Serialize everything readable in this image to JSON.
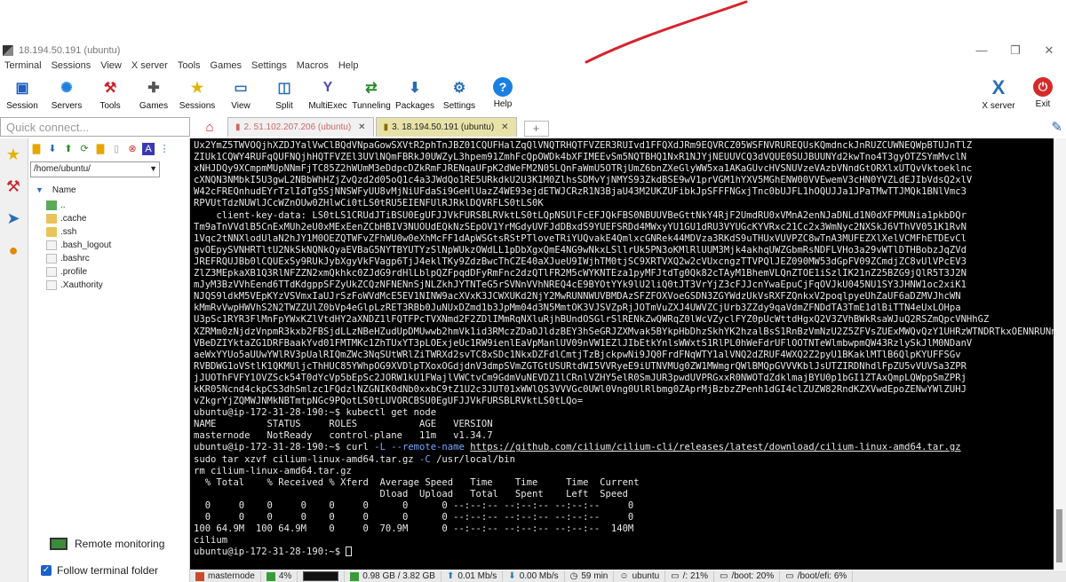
{
  "window": {
    "title": "18.194.50.191 (ubuntu)"
  },
  "menu": [
    "Terminal",
    "Sessions",
    "View",
    "X server",
    "Tools",
    "Games",
    "Settings",
    "Macros",
    "Help"
  ],
  "toolbar": [
    {
      "label": "Session",
      "icon": "session-icon",
      "color": "#1f5fbf"
    },
    {
      "label": "Servers",
      "icon": "servers-icon",
      "color": "#1f7fdf"
    },
    {
      "label": "Tools",
      "icon": "tools-icon",
      "color": "#c8242c"
    },
    {
      "label": "Games",
      "icon": "games-icon",
      "color": "#555555"
    },
    {
      "label": "Sessions",
      "icon": "star-icon",
      "color": "#e3b300"
    },
    {
      "label": "View",
      "icon": "view-icon",
      "color": "#2a6db5"
    },
    {
      "label": "Split",
      "icon": "split-icon",
      "color": "#2a6db5"
    },
    {
      "label": "MultiExec",
      "icon": "multiexec-icon",
      "color": "#4a4ab0"
    },
    {
      "label": "Tunneling",
      "icon": "tunneling-icon",
      "color": "#2a8a2a"
    },
    {
      "label": "Packages",
      "icon": "packages-icon",
      "color": "#2a6db5"
    },
    {
      "label": "Settings",
      "icon": "gear-icon",
      "color": "#2a6db5"
    },
    {
      "label": "Help",
      "icon": "help-icon",
      "color": "#1a7fe0"
    }
  ],
  "toolbar_right": [
    {
      "label": "X server",
      "icon": "xserver-icon",
      "color": "#2a6db5"
    },
    {
      "label": "Exit",
      "icon": "power-icon",
      "color": "#d42a2a"
    }
  ],
  "quick_connect": {
    "placeholder": "Quick connect..."
  },
  "tabs": [
    {
      "label": "2. 51.102.207.206 (ubuntu)",
      "active": false
    },
    {
      "label": "3. 18.194.50.191 (ubuntu)",
      "active": true
    }
  ],
  "sftp": {
    "path": "/home/ubuntu/",
    "column": "Name",
    "files": [
      {
        "name": "..",
        "type": "up"
      },
      {
        "name": ".cache",
        "type": "folder"
      },
      {
        "name": ".ssh",
        "type": "folder"
      },
      {
        "name": ".bash_logout",
        "type": "doc"
      },
      {
        "name": ".bashrc",
        "type": "doc"
      },
      {
        "name": ".profile",
        "type": "doc"
      },
      {
        "name": ".Xauthority",
        "type": "doc"
      }
    ],
    "remote_monitoring": "Remote monitoring",
    "follow_terminal": "Follow terminal folder"
  },
  "terminal": {
    "lines_before": [
      "Ux2YmZ5TWVOQjhXZDJYalVwClBQdVNpaGowSXVtR2phTnJBZ01CQUFHalZqQlVNQTRHQTFVZER3RUIvd1FFQXdJRm9EQVRCZ05WSFNVRUREQUsKQmdnckJnRUZCUWNEQWpBTUJnTlZ",
      "ZIUk1CQWY4RUFqQUFNQjhHQTFVZEl3UVlNQmFBRkJ0UWZyL3hpem91ZmhFcQpOWDk4bXFIMEEvSm5NQTBHQ1NxR1NJYjNEUUVCQ3dVQUE0SUJBUUNYd2kwTno4T3gyOTZSYmMvclN",
      "xNHJDQy9XCmpmMUpNNmFjTC85Z2hWUmM3eDdpcDZkRmFJRENqaUFpK2dWeFM2N05LQnFaWmU5OTRjUmZ6bnZXeGlyWW5xa1AKaGUvcHVSNUVzeVAzbVNndGtORXlxUTQvVktoeklnc",
      "cXNQN3NMbkI5U3gwL2NBbWhHZjZvQzd2d05oQ1c4a3JWdQo1RE5URkdkU2U3K1M0ZlhsSDMvYjNMYS93ZkdBSE9wV1prVGM1hYXV5MGhENW00VVEwemV3cHN0YVZLdEJIbVdsQ2xlV",
      "W42cFREQnhudEYrTzlIdTg5SjNNSWFyUU8vMjNiUFdaSi9GeHlUazZ4WE93ejdETWJCRzR1N3BjaU43M2UKZUFibkJpSFFFNGxjTnc0bUJFL1hOQUJJa1JPaTMwTTJMQk1BNlVmc3",
      "RPVUtTdzNUWlJCcWZnOUw0ZHlwCi0tLS0tRU5EIENFUlRJRklDQVRFLS0tLS0K",
      "    client-key-data: LS0tLS1CRUdJTiBSU0EgUFJJVkFURSBLRVktLS0tLQpNSUlFcEFJQkFBS0NBUUVBeGttNkY4RjF2UmdRU0xVMnA2enNJaDNLd1N0dXFPMUNia1pkbDQr",
      "Tm9aTnVVdlB5CnExMUh2eU0xMExEenZCbHBIV3NUOUdEQkNzSEpOV1YrMGdyUVFJdDBxdS9YUEFSRDd4MWxyYU1GU1dRU3VYUGcKYVRxc21Cc2x3WmNyc2NXSkJ6VThVV051K1RvN",
      "1Vqc2tNNXlodUlaN2hJY1M0OEZQTWFvZFhWU0w0eXhMcFF1dApWSGtsRStPTloveTRiYUQvakE4QmlxcGNRek44MDVza3RKdS9uTHUxVUVPZC8wTnA3MUFEZXlXelVCMFhETDEvCl",
      "gvOEpySVNHRTltU2NkSkNQNkQyaEVBaG5NYTBYUTYzSlNpWUkzOWdLL1pDbXgxQmE4NG9wNkxLSllrUk5PN3oKMlRlUUM3Mjk4akhqUWZGbmRsNDFLVHo3a29vWTlDTHBobzJqZVd",
      "JREFRQUJBb0lCQUExSy9RUkJybXgyVkFVagp6TjJ4eklTKy9ZdzBwcThCZE40aXJueU9IWjhTM0tjSC9XRTVXQ2w2cVUxcngzTTVPQlJEZ090MW53dGpFV09ZCmdjZC8vUlVPcEV3",
      "ZlZ3MEpkaXB1Q3RlNFZZN2xmQkhkc0ZJdG9rdHlLblpQZFpqdDFyRmFnc2dzQTlFR2M5cWYKNTEza1pyMFJtdTg0Qk82cTAyM1BhemVLQnZTOE1iSzlIK21nZ25BZG9jQlR5T3J2N",
      "mJyM3BzVVhEend6TTdKdgppSFZyUkZCQzNFNENnSjNLZkhJYTNTeG5rSVNnVVhNREQ4cE9BYOtYYk9lU2liQ0tJT3VrYjZ3cFJJcnYwaEpuCjFqOVJkU045NU1SY3JHNW1oc2xiK1",
      "NJQS9ldkM5VEpKYzVSVmxIaUJrSzFoWVdMcE5EV1NINW9acXVxK3JCWXUKd2NjY2MwRUNNWUVBMDAzSFZFOXVoeGSDN3ZGYWdzUkVsRXFZQnkxV2poqlpyeUhZaUF6aDZMVJhcWN",
      "kMmRvVwpHWVhS2N2TWZZUlZ0bVp4eGlpLzRET3RBb0JuNUxDZmd1b3JpMm04d3N5MmtOK3VJSVZpRjJOTmVuZXJ4UWVZCjUrb3ZZdy9qaVdmZFNDdTA3TmE1dlBiTTN4eUxLOHpa",
      "U3pSc1RYR3FlMnFpYWxKZlVtdHY2aXNDZ1lFQTFPcTVXNmd2F2ZDlIMmRqNXluRjhBUndOSGlrSlRENkZwQWRqZ0lWcVZyclFYZ0pUcWttdHgxQ2V3ZVhBWkRsaWJuQ2RSZmQpcVNHhGZ",
      "XZRMm0zNjdzVnpmR3kxb2FBSjdLLzNBeHZudUpDMUwwb2hmVk1id3RMczZDaDJldzBEY3hSeGRJZXMvak5BYkpHbDhzSkhYK2hzalBsS1RnBzVmNzU2Z5ZFVsZUExMWQvQzY1UHRzWTNDRTkxOENNRUNnWU",
      "VBeDZIYktaZG1DRFBaakYvd01FMTMKc1ZhTUxYT3pLOExjeUc1RW9ienlEaVpManlUV09nVW1EZlJIbEtkYnlsWWxtS1RlPL0hWeFdrUFlOOTNTeWlmbwpmQW43RzlySkJlM0NDanV",
      "aeWxYYUo5aUUwYWlRV3pUalRIQmZWc3NqSUtWRlZiTWRXd2svTC8xSDc1NkxDZFdlCmtjTzBjckpwNi9JQ0FrdFNqWTY1alVNQ2dZRUF4WXQ2Z2pyU1BKaklMTlB6QlpKYUFFSGv",
      "RVBDWG1oVStlK1QKMUljcThHUC85YWhpOG9XVDlpTXoxOGdjdnV3dmpSVmZGTGtUSURtdWI5VVRyeE9iUTNVMUg0ZW1MWmgrQWlBMQpGVVVKblJsUTZIRDNhdlFpZU5vVUVSa3ZPR",
      "jJUOThFVFY1OVZSck54T0dYcVp5bEpSc2JORW1kU1FWajlVWCtvCm9GdmVuNEVDZ1lCRnlVZHY5elR0SmJUR3pwdUVPRGxxR0NWOTdZdklmajBYU0p1bGI1ZTAxQmpLQWppSmZPRj",
      "kKR05Ncnd4ckpCS3dhSmlzc1FQdzlNZGNIK0dNb0xxbC9tZ1U2c3JUT01xWWlQS3VVVGc0UWl0Vng0UlRlbmg0ZAprMjBzbzZPenh1dGI4clZUZW82RndKZXVwdEpoZENwYWlZUHJ",
      "vZkgrYjZQMWJNMkNBTmtpNGc9PQotLS0tLUVORCBSU0EgUFJJVkFURSBLRVktLS0tLQo="
    ],
    "prompt": "ubuntu@ip-172-31-28-190:~$",
    "cmd1": "kubectl get node",
    "node_header": "NAME         STATUS     ROLES           AGE   VERSION",
    "node_row": "masternode   NotReady   control-plane   11m   v1.34.7",
    "cmd2_pre": "curl",
    "cmd2_opt": "-L --remote-name",
    "cmd2_url": "https://github.com/cilium/cilium-cli/releases/latest/download/cilium-linux-amd64.tar.gz",
    "cmd3_pre": "sudo tar xzvf cilium-linux-amd64.tar.gz",
    "cmd3_opt": "-C",
    "cmd3_post": "/usr/local/bin",
    "cmd4": "rm cilium-linux-amd64.tar.gz",
    "curl_h1": "  % Total    % Received % Xferd  Average Speed   Time    Time     Time  Current",
    "curl_h2": "                                 Dload  Upload   Total   Spent    Left  Speed",
    "curl_r1": "  0     0    0     0    0     0      0      0 --:--:-- --:--:-- --:--:--     0",
    "curl_r2": "  0     0    0     0    0     0      0      0 --:--:-- --:--:-- --:--:--     0",
    "curl_r3": "100 64.9M  100 64.9M    0     0  70.9M      0 --:--:-- --:--:-- --:--:--  140M",
    "out_cilium": "cilium"
  },
  "status": [
    {
      "label": "masternode",
      "icon": "server-icon",
      "color": "#c84a2a"
    },
    {
      "label": "4%",
      "icon": "cpu-icon",
      "color": "#3a9a3a"
    },
    {
      "label": "",
      "icon": "cpu-graph-icon",
      "color": "#111111"
    },
    {
      "label": "0.98 GB / 3.82 GB",
      "icon": "memory-icon",
      "color": "#3a9a3a"
    },
    {
      "label": "0.01 Mb/s",
      "icon": "upload-icon",
      "color": "#2a7ab0"
    },
    {
      "label": "0.00 Mb/s",
      "icon": "download-icon",
      "color": "#2a7ab0"
    },
    {
      "label": "59 min",
      "icon": "clock-icon",
      "color": "#333333"
    },
    {
      "label": "ubuntu",
      "icon": "user-icon",
      "color": "#333333"
    },
    {
      "label": "/: 21%",
      "icon": "disk-icon",
      "color": "#333333"
    },
    {
      "label": "/boot: 20%",
      "icon": "disk-icon",
      "color": "#333333"
    },
    {
      "label": "/boot/efi: 6%",
      "icon": "disk-icon",
      "color": "#333333"
    }
  ]
}
